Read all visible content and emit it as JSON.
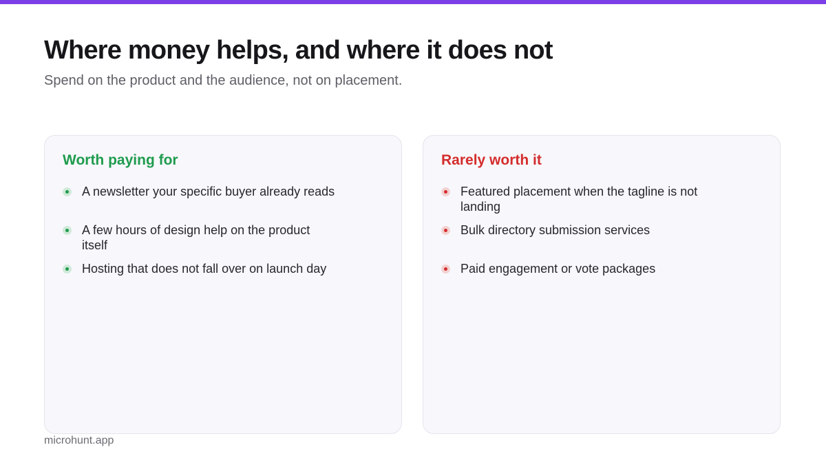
{
  "slide": {
    "title": "Where money helps, and where it does not",
    "subtitle": "Spend on the product and the audience, not on placement.",
    "footer": "microhunt.app"
  },
  "colors": {
    "accent_bar": "#7b3fe8",
    "good": "#1f9b4e",
    "bad": "#d42d2d"
  },
  "worth": {
    "heading": "Worth paying for",
    "items": [
      "A newsletter your specific buyer already reads",
      "A few hours of design help on the product itself",
      "Hosting that does not fall over on launch day"
    ]
  },
  "rarely": {
    "heading": "Rarely worth it",
    "items": [
      "Featured placement when the tagline is not landing",
      "Bulk directory submission services",
      "Paid engagement or vote packages"
    ]
  }
}
